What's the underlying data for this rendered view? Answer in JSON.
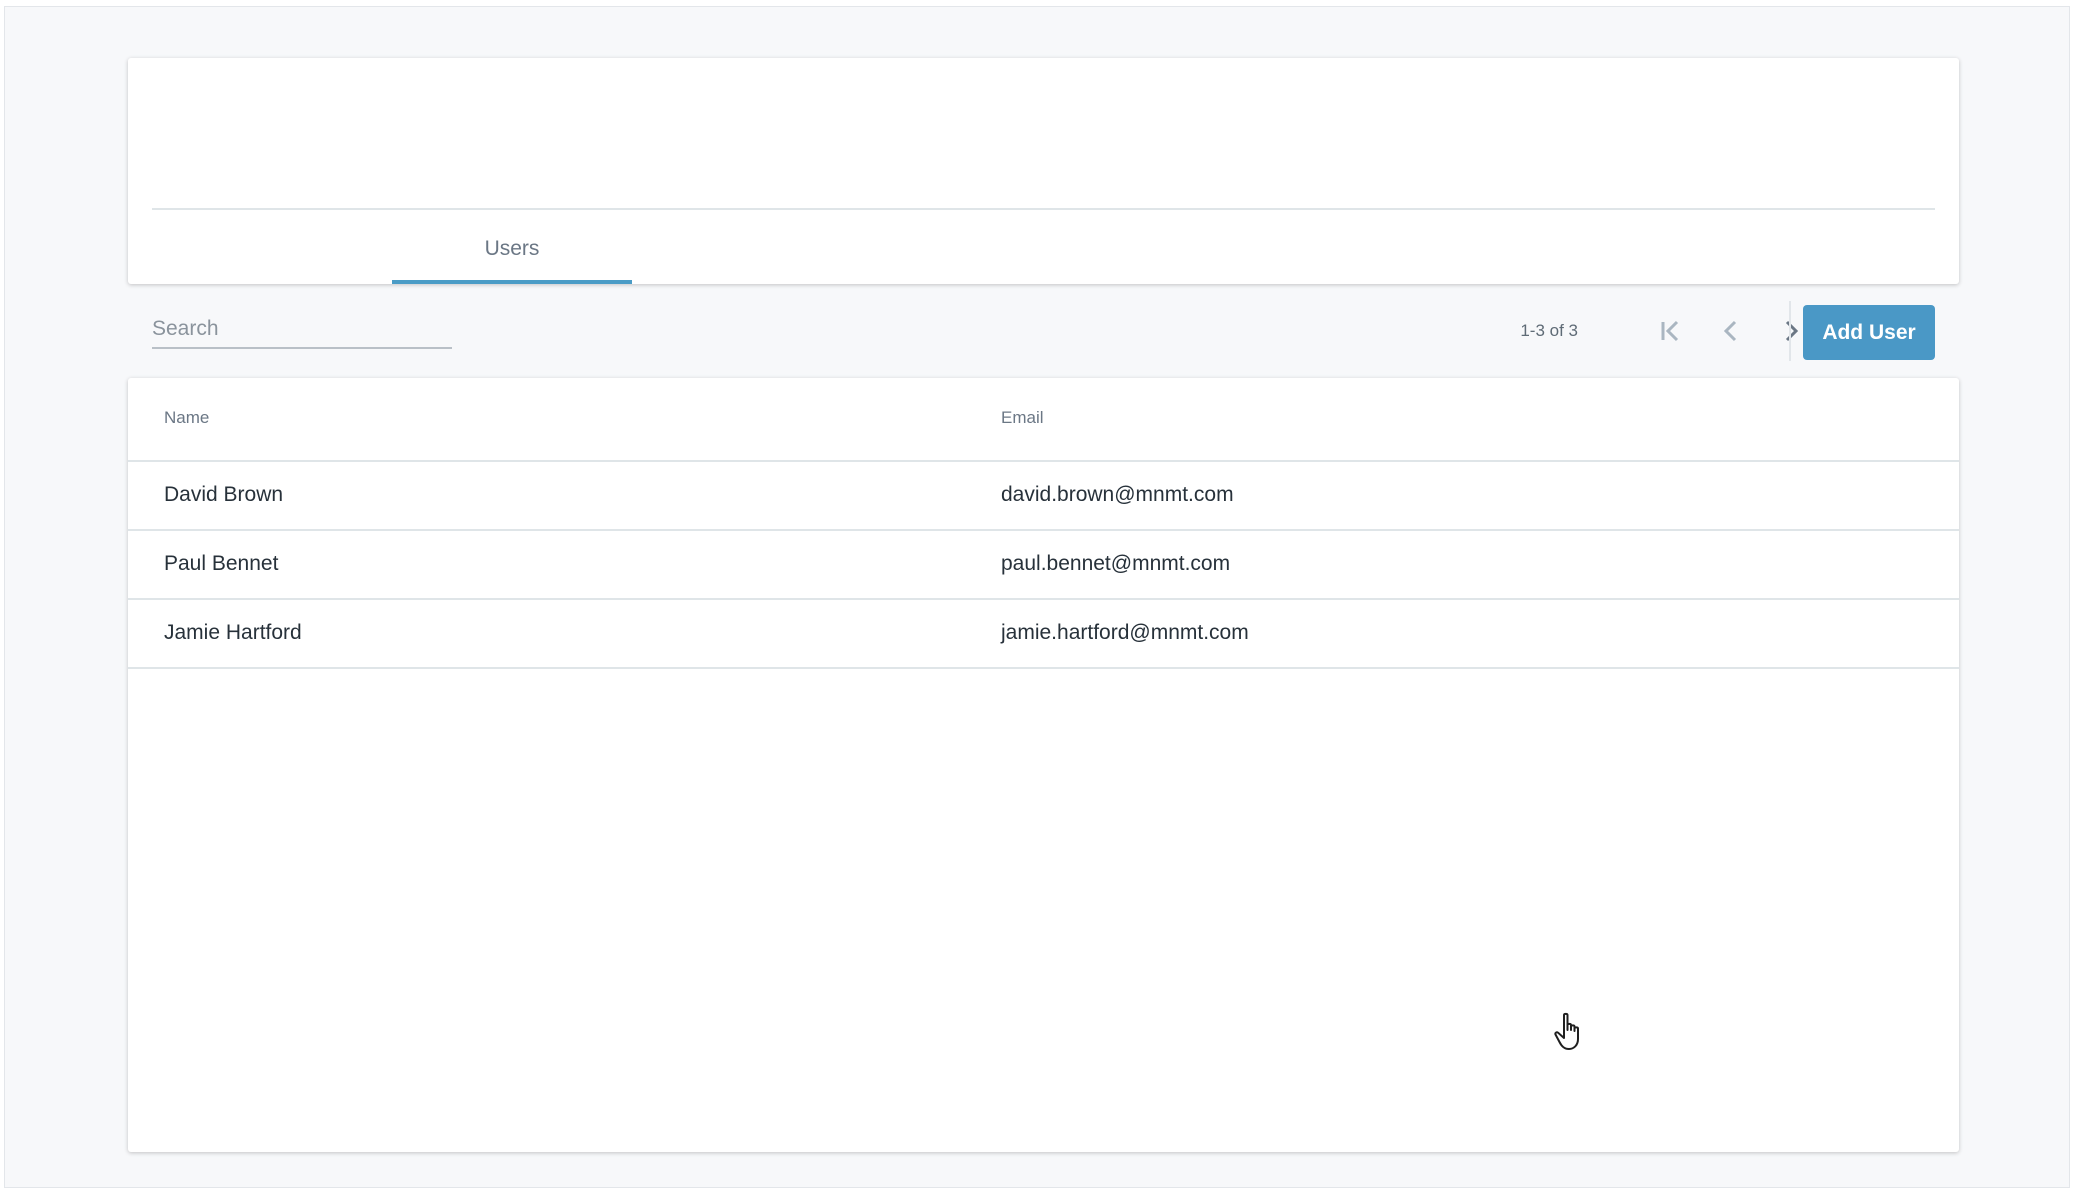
{
  "tabs": [
    {
      "label": "Users",
      "active": true
    }
  ],
  "search": {
    "placeholder": "Search"
  },
  "pagination": {
    "range_label": "1-3 of 3"
  },
  "toolbar": {
    "add_label": "Add User"
  },
  "table": {
    "columns": [
      "Name",
      "Email"
    ],
    "rows": [
      {
        "name": "David Brown",
        "email": "david.brown@mnmt.com"
      },
      {
        "name": "Paul Bennet",
        "email": "paul.bennet@mnmt.com"
      },
      {
        "name": "Jamie Hartford",
        "email": "jamie.hartford@mnmt.com"
      }
    ]
  },
  "colors": {
    "accent": "#4a98c6",
    "tab_underline": "#4a9cc6"
  },
  "icons": [
    "first-page-icon",
    "previous-page-icon",
    "next-page-icon",
    "hand-cursor-icon"
  ]
}
